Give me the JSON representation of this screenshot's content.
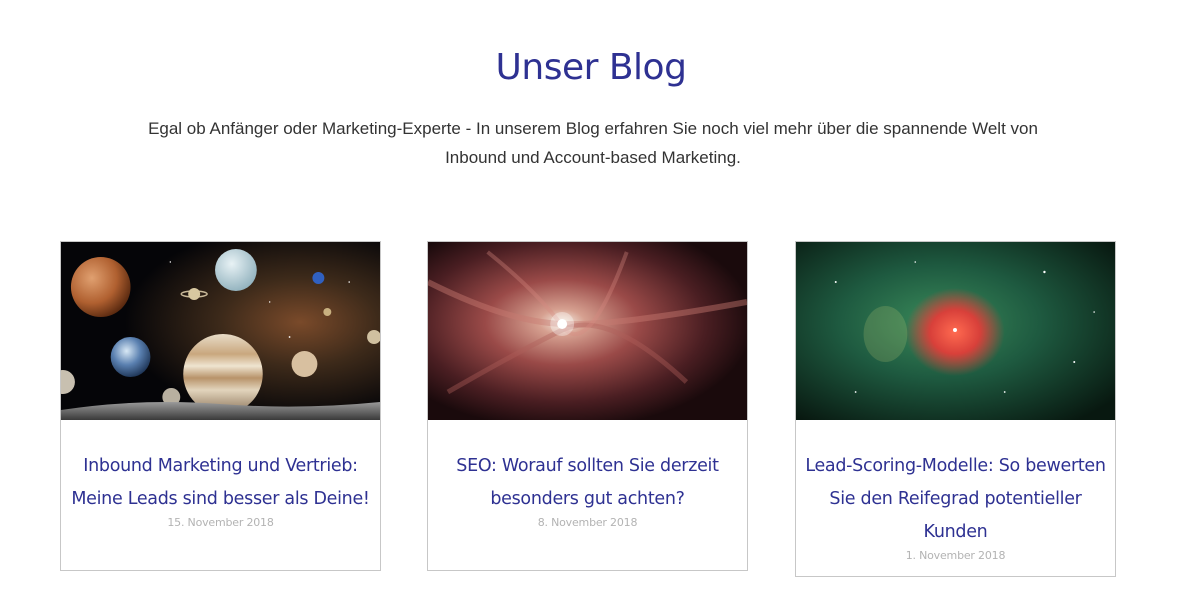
{
  "header": {
    "title": "Unser Blog",
    "intro": "Egal ob Anfänger oder Marketing-Experte - In unserem Blog erfahren Sie noch viel mehr über die spannende Welt von Inbound und Account-based Marketing."
  },
  "posts": [
    {
      "title": "Inbound Marketing und Vertrieb: Meine Leads sind besser als Deine!",
      "date": "15. November 2018",
      "image": "planets-space-image"
    },
    {
      "title": "SEO: Worauf sollten Sie derzeit besonders gut achten?",
      "date": "8. November 2018",
      "image": "red-nebula-image"
    },
    {
      "title": "Lead-Scoring-Modelle: So bewerten Sie den Reifegrad potentieller Kunden",
      "date": "1. November 2018",
      "image": "green-red-nebula-image"
    }
  ],
  "colors": {
    "heading": "#2e3192",
    "text": "#333333",
    "date": "#b3b3b3",
    "border": "#c7c7c7"
  }
}
